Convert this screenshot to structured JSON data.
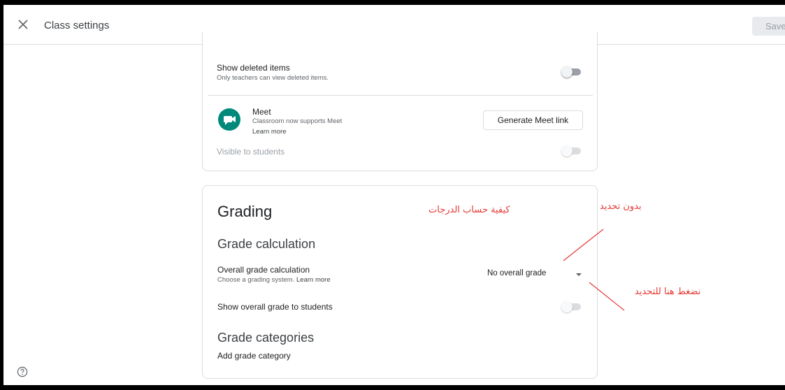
{
  "header": {
    "title": "Class settings",
    "save_label": "Save"
  },
  "general": {
    "show_deleted": {
      "title": "Show deleted items",
      "subtitle": "Only teachers can view deleted items.",
      "enabled": false
    },
    "meet": {
      "title": "Meet",
      "subtitle": "Classroom now supports Meet",
      "learn_more": "Learn more",
      "button_label": "Generate Meet link",
      "visible_label": "Visible to students",
      "visible_enabled": false
    }
  },
  "grading": {
    "title": "Grading",
    "calculation_heading": "Grade calculation",
    "overall": {
      "title": "Overall grade calculation",
      "subtitle": "Choose a grading system.",
      "learn_more": "Learn more",
      "selected": "No overall grade"
    },
    "show_overall": {
      "label": "Show overall grade to students",
      "enabled": false
    },
    "categories_heading": "Grade categories",
    "add_category": "Add grade category"
  },
  "annotations": {
    "grade_calc_note": "كيفية حساب الدرجات",
    "no_selection_note": "بدون تحديد",
    "click_here_note": "نضغط هنا للتحديد",
    "color": "#e53935"
  },
  "icons": {
    "close": "close-icon",
    "meet": "meet-icon",
    "dropdown": "caret-down-icon",
    "help": "help-circle-icon"
  },
  "colors": {
    "meet_green": "#00897b",
    "save_disabled_bg": "#e8eaed"
  }
}
